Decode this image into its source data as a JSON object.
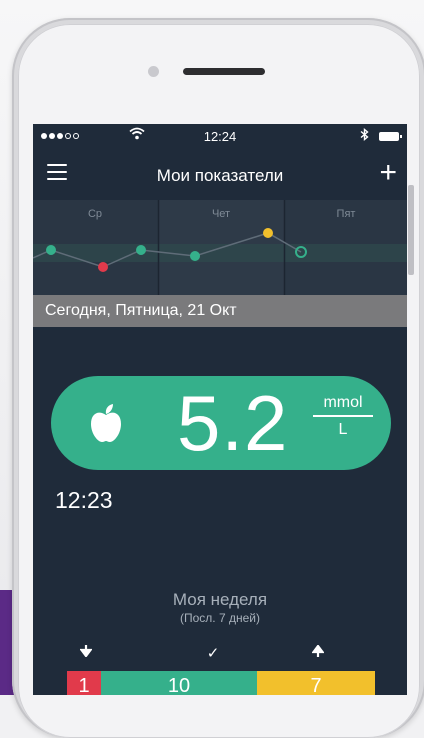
{
  "status_bar": {
    "time": "12:24",
    "signal_icon": "signal-dots-icon",
    "wifi_icon": "wifi-icon",
    "bluetooth_icon": "bluetooth-icon",
    "battery_icon": "battery-icon"
  },
  "nav": {
    "title": "Мои показатели",
    "menu_icon": "hamburger-menu-icon",
    "add_icon": "plus-icon",
    "add_label": "+"
  },
  "chart_data": {
    "type": "line",
    "categories": [
      "Ср",
      "Чет",
      "Пят"
    ],
    "points": [
      {
        "status": "normal",
        "color": "#35b08b"
      },
      {
        "status": "low",
        "color": "#e13a4b"
      },
      {
        "status": "normal",
        "color": "#35b08b"
      },
      {
        "status": "normal",
        "color": "#35b08b"
      },
      {
        "status": "high",
        "color": "#f2c02c"
      },
      {
        "status": "open",
        "color": "#35b08b"
      }
    ]
  },
  "date_header": "Сегодня, Пятница, 21 Окт",
  "reading": {
    "value": "5.2",
    "unit_top": "mmol",
    "unit_bottom": "L",
    "icon": "apple-icon",
    "time": "12:23",
    "color": "#35b08b"
  },
  "week": {
    "title": "Моя неделя",
    "subtitle": "(Посл. 7 дней)",
    "stats": [
      {
        "icon": "arrow-down-icon",
        "glyph": "↓",
        "value": "1",
        "color": "#e13a4b"
      },
      {
        "icon": "checkmark-icon",
        "glyph": "✓",
        "value": "10",
        "color": "#35b08b"
      },
      {
        "icon": "arrow-up-icon",
        "glyph": "↑",
        "value": "7",
        "color": "#f2c02c"
      }
    ]
  }
}
